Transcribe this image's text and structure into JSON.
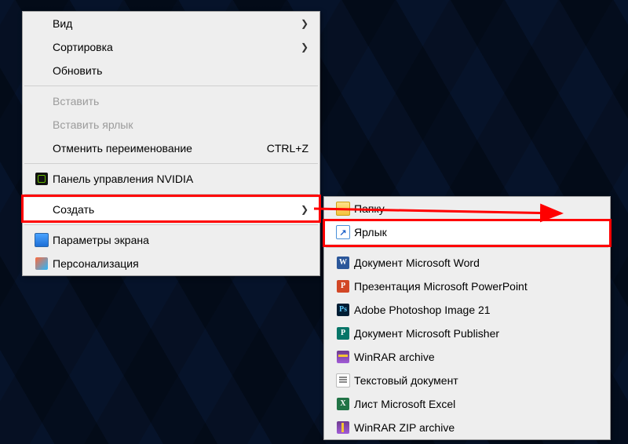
{
  "main_menu": {
    "view": "Вид",
    "sort": "Сортировка",
    "refresh": "Обновить",
    "paste": "Вставить",
    "paste_shortcut": "Вставить ярлык",
    "undo_rename": "Отменить переименование",
    "undo_rename_shortcut": "CTRL+Z",
    "nvidia": "Панель управления NVIDIA",
    "create": "Создать",
    "display_settings": "Параметры экрана",
    "personalize": "Персонализация"
  },
  "sub_menu": {
    "folder": "Папку",
    "shortcut": "Ярлык",
    "word": "Документ Microsoft Word",
    "powerpoint": "Презентация Microsoft PowerPoint",
    "photoshop": "Adobe Photoshop Image 21",
    "publisher": "Документ Microsoft Publisher",
    "winrar": "WinRAR archive",
    "text": "Текстовый документ",
    "excel": "Лист Microsoft Excel",
    "zip": "WinRAR ZIP archive"
  }
}
